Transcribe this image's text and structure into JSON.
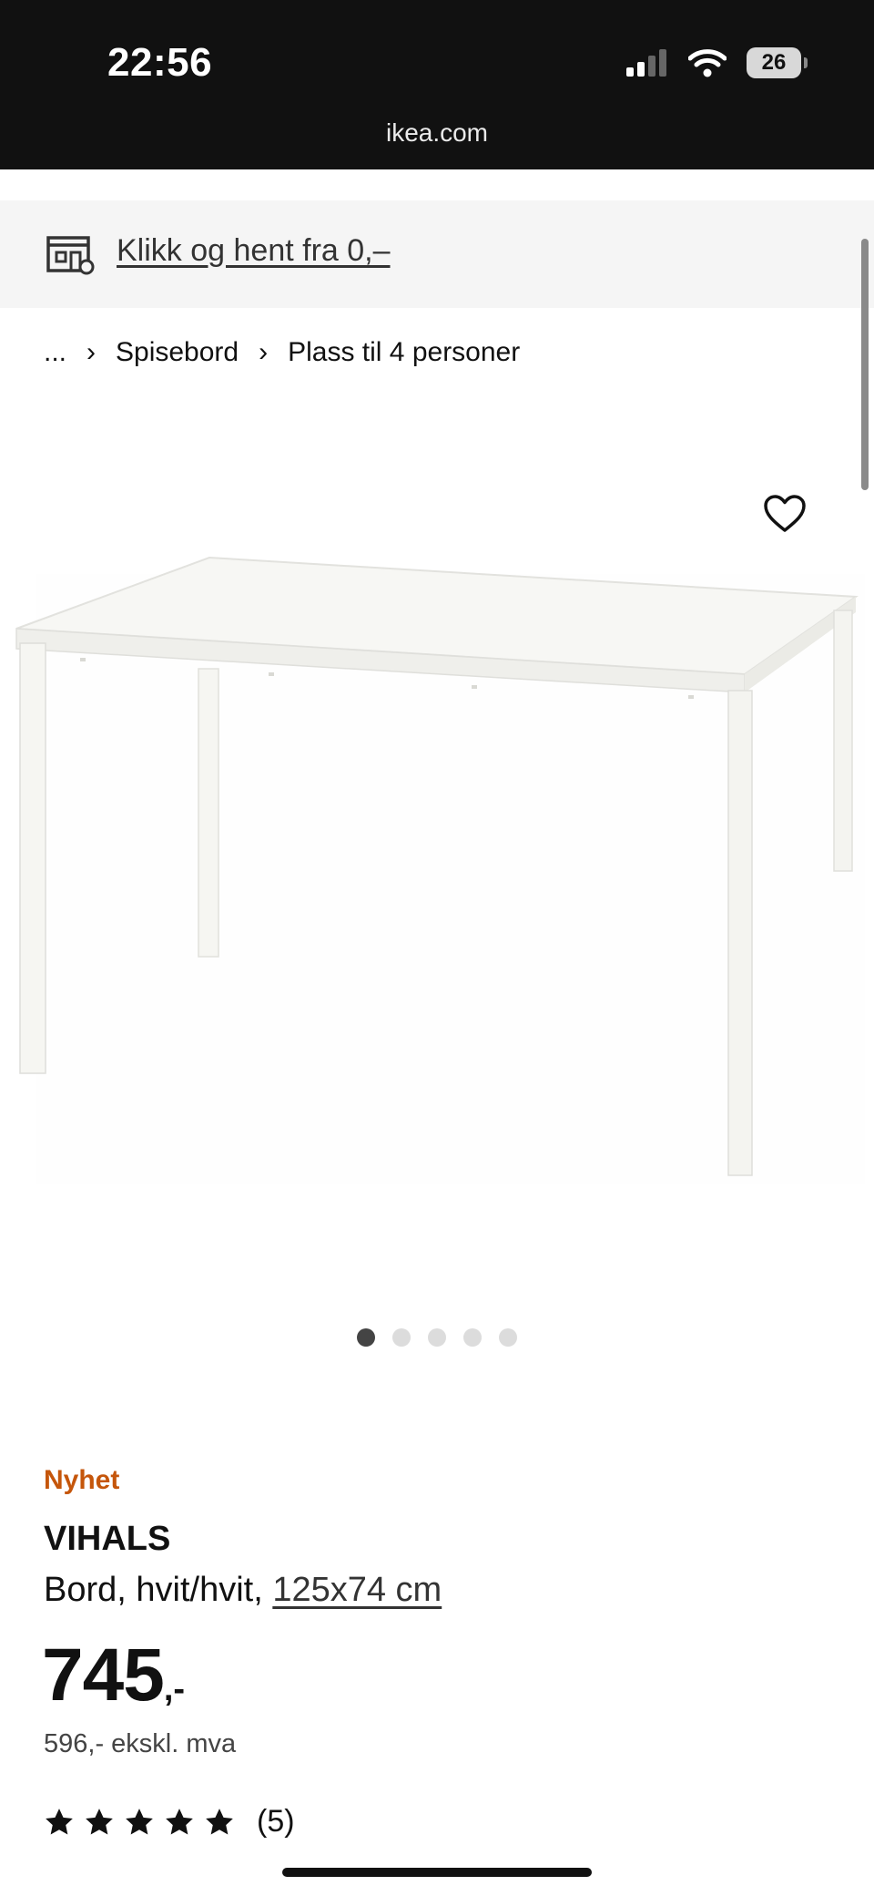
{
  "status_bar": {
    "time": "22:56",
    "battery": "26",
    "url": "ikea.com"
  },
  "promo": {
    "text": "Klikk og hent fra 0,–",
    "icon": "store-pickup-icon"
  },
  "breadcrumb": {
    "ellipsis": "...",
    "items": [
      "Spisebord",
      "Plass til 4 personer"
    ]
  },
  "gallery": {
    "image_count": 5,
    "active_index": 0
  },
  "product": {
    "badge": "Nyhet",
    "name": "VIHALS",
    "description": "Bord, hvit/hvit, ",
    "dimensions": "125x74 cm",
    "price": "745",
    "price_suffix": ",-",
    "price_ex_vat": "596,- ekskl. mva",
    "rating_stars": 5,
    "review_count": "(5)"
  },
  "colors": {
    "badge": "#c5560b",
    "statusbar": "#111111",
    "promo_bg": "#f5f5f5"
  }
}
